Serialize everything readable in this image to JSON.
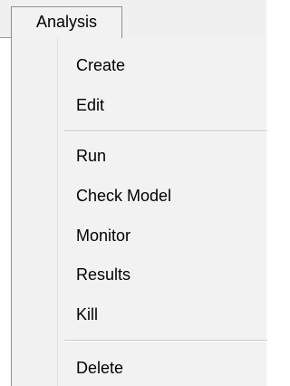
{
  "menu": {
    "title": "Analysis",
    "items": [
      {
        "label": "Create"
      },
      {
        "label": "Edit"
      },
      {
        "label": "Run"
      },
      {
        "label": "Check Model"
      },
      {
        "label": "Monitor"
      },
      {
        "label": "Results"
      },
      {
        "label": "Kill"
      },
      {
        "label": "Delete"
      }
    ]
  }
}
